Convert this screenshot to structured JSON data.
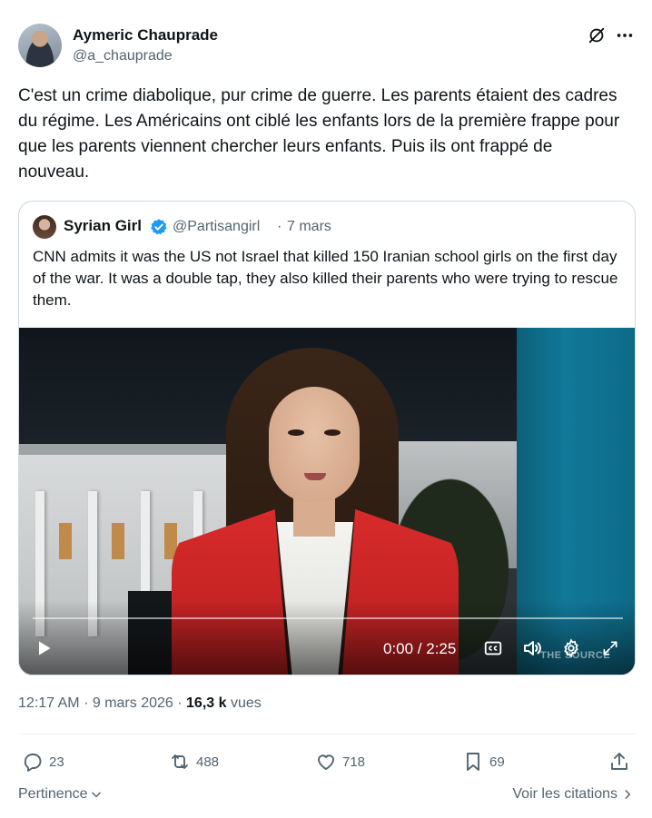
{
  "author": {
    "name": "Aymeric Chauprade",
    "handle": "@a_chauprade"
  },
  "tweet": {
    "text": "C'est un crime diabolique, pur crime de guerre. Les parents étaient des cadres du régime. Les Américains ont ciblé les enfants lors de la première frappe pour que les parents viennent chercher leurs enfants. Puis ils ont frappé de nouveau."
  },
  "quote": {
    "name": "Syrian Girl",
    "handle": "@Partisangirl",
    "separator": "·",
    "date": "7 mars",
    "text": "CNN admits it was the US not Israel that killed 150 Iranian school girls on the first day of the war. It was a double tap, they also killed their parents who were trying to rescue them.",
    "verified_color": "#1d9bf0",
    "video": {
      "time": "0:00 / 2:25",
      "progress": 0,
      "watermark": "THE SOURCE"
    }
  },
  "meta": {
    "time": "12:17 AM",
    "sep1": "·",
    "date": "9 mars 2026",
    "sep2": "·",
    "views_count": "16,3 k",
    "views_label": "vues"
  },
  "actions": {
    "replies": "23",
    "reposts": "488",
    "likes": "718",
    "bookmarks": "69"
  },
  "footer": {
    "sort_label": "Pertinence",
    "quotes_link": "Voir les citations"
  }
}
